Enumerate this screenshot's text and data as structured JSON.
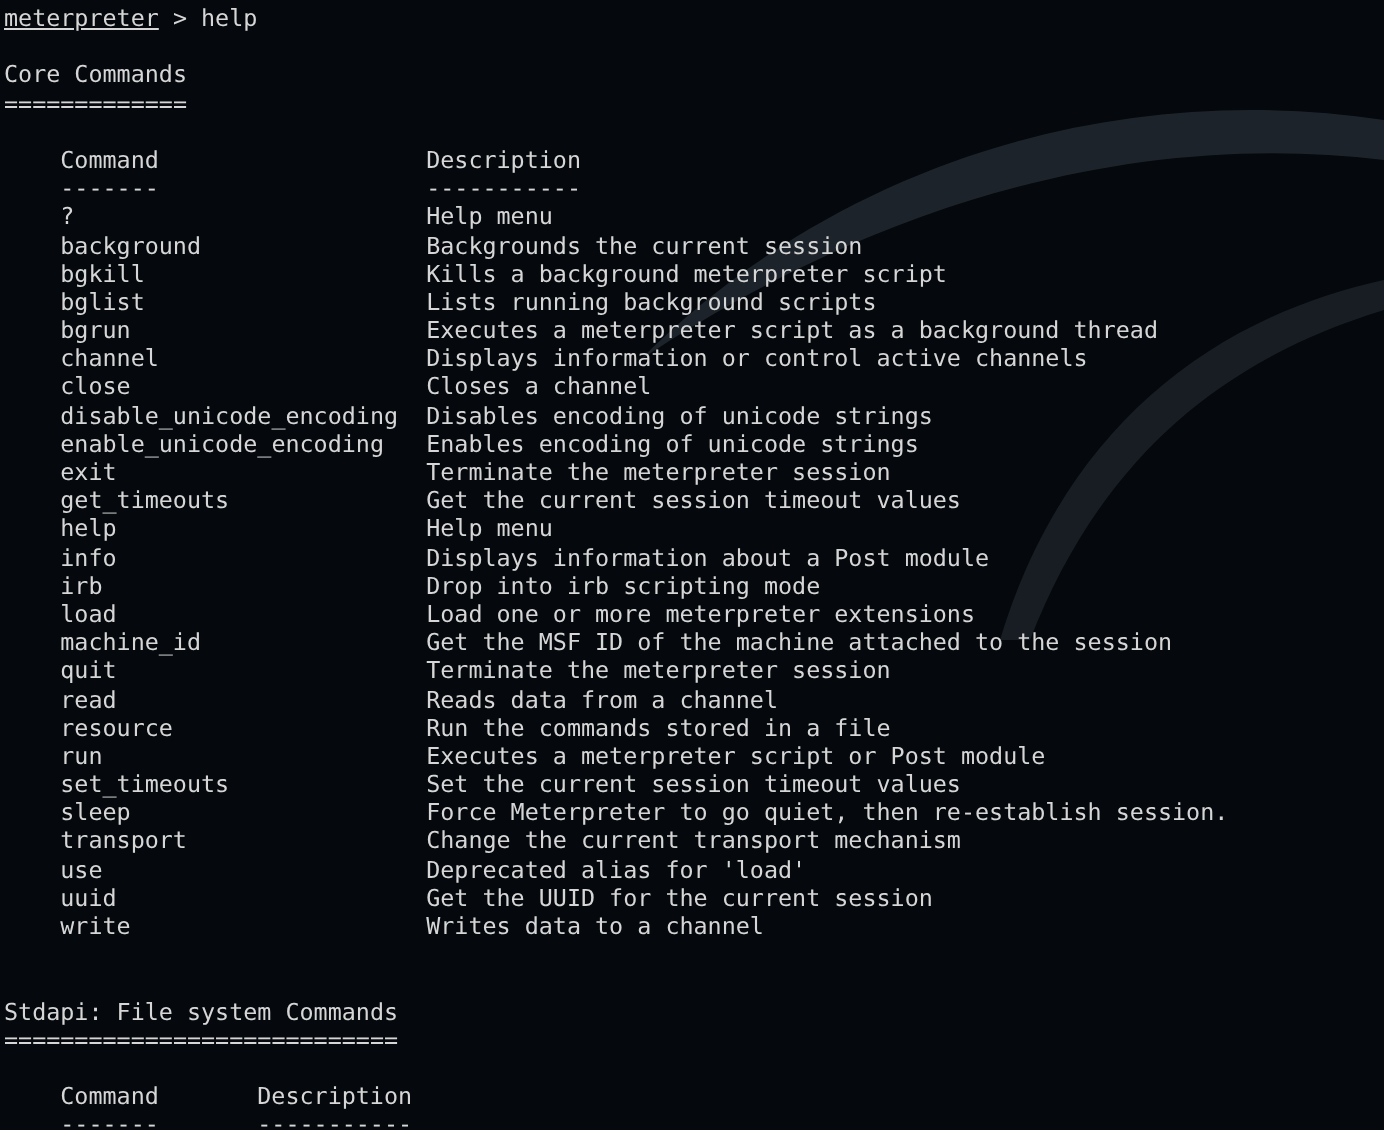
{
  "prompt": {
    "name": "meterpreter",
    "symbol": ">",
    "command": "help"
  },
  "sections": [
    {
      "title": "Core Commands",
      "underline": "=============",
      "columns": [
        "Command",
        "Description"
      ],
      "column_rules": [
        "-------",
        "-----------"
      ],
      "rows": [
        {
          "command": "?",
          "description": "Help menu"
        },
        {
          "command": "background",
          "description": "Backgrounds the current session"
        },
        {
          "command": "bgkill",
          "description": "Kills a background meterpreter script"
        },
        {
          "command": "bglist",
          "description": "Lists running background scripts"
        },
        {
          "command": "bgrun",
          "description": "Executes a meterpreter script as a background thread"
        },
        {
          "command": "channel",
          "description": "Displays information or control active channels"
        },
        {
          "command": "close",
          "description": "Closes a channel"
        },
        {
          "command": "disable_unicode_encoding",
          "description": "Disables encoding of unicode strings"
        },
        {
          "command": "enable_unicode_encoding",
          "description": "Enables encoding of unicode strings"
        },
        {
          "command": "exit",
          "description": "Terminate the meterpreter session"
        },
        {
          "command": "get_timeouts",
          "description": "Get the current session timeout values"
        },
        {
          "command": "help",
          "description": "Help menu"
        },
        {
          "command": "info",
          "description": "Displays information about a Post module"
        },
        {
          "command": "irb",
          "description": "Drop into irb scripting mode"
        },
        {
          "command": "load",
          "description": "Load one or more meterpreter extensions"
        },
        {
          "command": "machine_id",
          "description": "Get the MSF ID of the machine attached to the session"
        },
        {
          "command": "quit",
          "description": "Terminate the meterpreter session"
        },
        {
          "command": "read",
          "description": "Reads data from a channel"
        },
        {
          "command": "resource",
          "description": "Run the commands stored in a file"
        },
        {
          "command": "run",
          "description": "Executes a meterpreter script or Post module"
        },
        {
          "command": "set_timeouts",
          "description": "Set the current session timeout values"
        },
        {
          "command": "sleep",
          "description": "Force Meterpreter to go quiet, then re-establish session."
        },
        {
          "command": "transport",
          "description": "Change the current transport mechanism"
        },
        {
          "command": "use",
          "description": "Deprecated alias for 'load'"
        },
        {
          "command": "uuid",
          "description": "Get the UUID for the current session"
        },
        {
          "command": "write",
          "description": "Writes data to a channel"
        }
      ]
    },
    {
      "title": "Stdapi: File system Commands",
      "underline": "============================",
      "columns": [
        "Command",
        "Description"
      ],
      "column_rules": [
        "-------",
        "-----------"
      ]
    }
  ]
}
